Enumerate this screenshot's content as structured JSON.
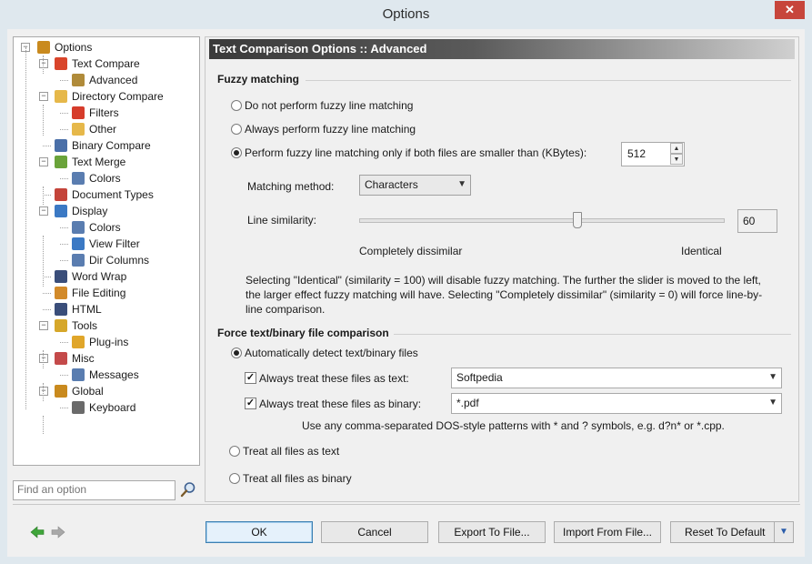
{
  "window": {
    "title": "Options",
    "close_glyph": "✕"
  },
  "tree": {
    "items": [
      {
        "label": "Options",
        "icon": "options-icon",
        "color": "#c98a1e"
      },
      {
        "label": "Text Compare",
        "icon": "text-compare-icon",
        "color": "#d9452b"
      },
      {
        "label": "Advanced",
        "icon": "wand-icon",
        "color": "#b08b3a"
      },
      {
        "label": "Directory Compare",
        "icon": "folder-icon",
        "color": "#e6b84a"
      },
      {
        "label": "Filters",
        "icon": "filter-icon",
        "color": "#d63c2b"
      },
      {
        "label": "Other",
        "icon": "folder-edit-icon",
        "color": "#e6b84a"
      },
      {
        "label": "Binary Compare",
        "icon": "binary-icon",
        "color": "#4a6fa8"
      },
      {
        "label": "Text Merge",
        "icon": "merge-icon",
        "color": "#6aa33a"
      },
      {
        "label": "Colors",
        "icon": "grid-icon",
        "color": "#5a7db0"
      },
      {
        "label": "Document Types",
        "icon": "document-types-icon",
        "color": "#c4443a"
      },
      {
        "label": "Display",
        "icon": "monitor-icon",
        "color": "#3b79c4"
      },
      {
        "label": "Colors",
        "icon": "grid-icon",
        "color": "#5a7db0"
      },
      {
        "label": "View Filter",
        "icon": "funnel-icon",
        "color": "#3b79c4"
      },
      {
        "label": "Dir Columns",
        "icon": "columns-icon",
        "color": "#5a7db0"
      },
      {
        "label": "Word Wrap",
        "icon": "word-wrap-icon",
        "color": "#3a4e7a"
      },
      {
        "label": "File Editing",
        "icon": "file-edit-icon",
        "color": "#d28a2a"
      },
      {
        "label": "HTML",
        "icon": "html-icon",
        "color": "#3a4e7a"
      },
      {
        "label": "Tools",
        "icon": "key-icon",
        "color": "#d6a72a"
      },
      {
        "label": "Plug-ins",
        "icon": "gear-icon",
        "color": "#e0a62a"
      },
      {
        "label": "Misc",
        "icon": "misc-icon",
        "color": "#c44a4a"
      },
      {
        "label": "Messages",
        "icon": "messages-icon",
        "color": "#5a7db0"
      },
      {
        "label": "Global",
        "icon": "global-icon",
        "color": "#c98a1e"
      },
      {
        "label": "Keyboard",
        "icon": "keyboard-icon",
        "color": "#6a6a6a"
      }
    ]
  },
  "search": {
    "placeholder": "Find an option",
    "icon": "search-icon"
  },
  "panel": {
    "header": "Text Comparison Options :: Advanced",
    "fuzzy": {
      "section_title": "Fuzzy matching",
      "opt_none": "Do not perform fuzzy line matching",
      "opt_always": "Always perform fuzzy line matching",
      "opt_smaller": "Perform fuzzy line matching only if both files are smaller than (KBytes):",
      "selected": "opt_smaller",
      "size_kb": "512",
      "method_label": "Matching method:",
      "method_value": "Characters",
      "similarity_label": "Line similarity:",
      "similarity_value": "60",
      "similarity_fraction": 0.6,
      "min_label": "Completely dissimilar",
      "max_label": "Identical",
      "description": "Selecting \"Identical\" (similarity = 100) will disable fuzzy matching. The further the slider is moved to the left, the larger effect fuzzy matching will have. Selecting \"Completely dissimilar\" (similarity = 0) will force line-by-line comparison."
    },
    "force": {
      "section_title": "Force text/binary file comparison",
      "opt_auto": "Automatically detect text/binary files",
      "text_label": "Always treat these files as text:",
      "text_checked": true,
      "text_value": "Softpedia",
      "binary_label": "Always treat these files as binary:",
      "binary_checked": true,
      "binary_value": "*.pdf",
      "hint": "Use any comma-separated DOS-style patterns with * and ? symbols, e.g. d?n* or *.cpp.",
      "opt_all_text": "Treat all files as text",
      "opt_all_binary": "Treat all files as binary"
    }
  },
  "footer": {
    "back_icon": "back-arrow-icon",
    "forward_icon": "forward-arrow-icon",
    "ok": "OK",
    "cancel": "Cancel",
    "export": "Export To File...",
    "import": "Import From File...",
    "reset": "Reset To Default"
  }
}
